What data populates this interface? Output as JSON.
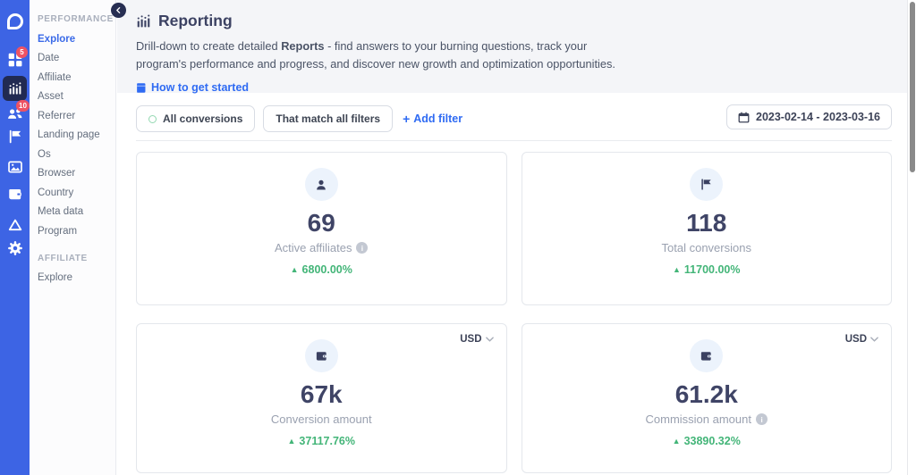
{
  "colors": {
    "rail_blue": "#3d64e4",
    "rail_active_bg": "#212a52",
    "badge_red": "#ee5263",
    "link_blue": "#2f6bf3",
    "positive_green": "#43b578",
    "heading_navy": "#3c4263",
    "label_gray": "#9aa1b0",
    "header_bg": "#f4f5f8"
  },
  "icon_rail": {
    "logo": "tapfiliate-logo",
    "items": [
      {
        "icon": "grid-icon",
        "badge": "5"
      },
      {
        "icon": "bar-chart-icon",
        "active": true
      },
      {
        "icon": "users-icon",
        "badge": "10"
      },
      {
        "icon": "flag-icon"
      },
      {
        "icon": "image-icon"
      },
      {
        "icon": "wallet-icon"
      },
      {
        "icon": "triangle-icon"
      },
      {
        "icon": "gear-icon"
      }
    ]
  },
  "sidebar": {
    "sections": [
      {
        "header": "PERFORMANCE",
        "items": [
          "Explore",
          "Date",
          "Affiliate",
          "Asset",
          "Referrer",
          "Landing page",
          "Os",
          "Browser",
          "Country",
          "Meta data",
          "Program"
        ],
        "active_item": "Explore"
      },
      {
        "header": "AFFILIATE",
        "items": [
          "Explore"
        ]
      }
    ]
  },
  "page_header": {
    "title": "Reporting",
    "description": {
      "before_bold": "Drill-down to create detailed ",
      "bold": "Reports",
      "after_bold": " - find answers to your burning questions, track your program's performance and progress, and discover new growth and optimization opportunities."
    },
    "help_link": "How to get started"
  },
  "filter_bar": {
    "all_conversions": "All conversions",
    "match_all": "That match all filters",
    "plus": "+",
    "add_filter": "Add filter",
    "date_range": "2023-02-14 - 2023-03-16"
  },
  "cards": [
    {
      "value": "69",
      "label": "Active affiliates",
      "delta": "6800.00%",
      "has_info": true
    },
    {
      "value": "118",
      "label": "Total conversions",
      "delta": "11700.00%",
      "has_info": false
    },
    {
      "value": "67k",
      "label": "Conversion amount",
      "delta": "37117.76%",
      "has_info": false,
      "currency": "USD"
    },
    {
      "value": "61.2k",
      "label": "Commission amount",
      "delta": "33890.32%",
      "has_info": true,
      "currency": "USD"
    }
  ],
  "misc": {
    "up_arrow": "▲",
    "info_glyph": "i"
  }
}
